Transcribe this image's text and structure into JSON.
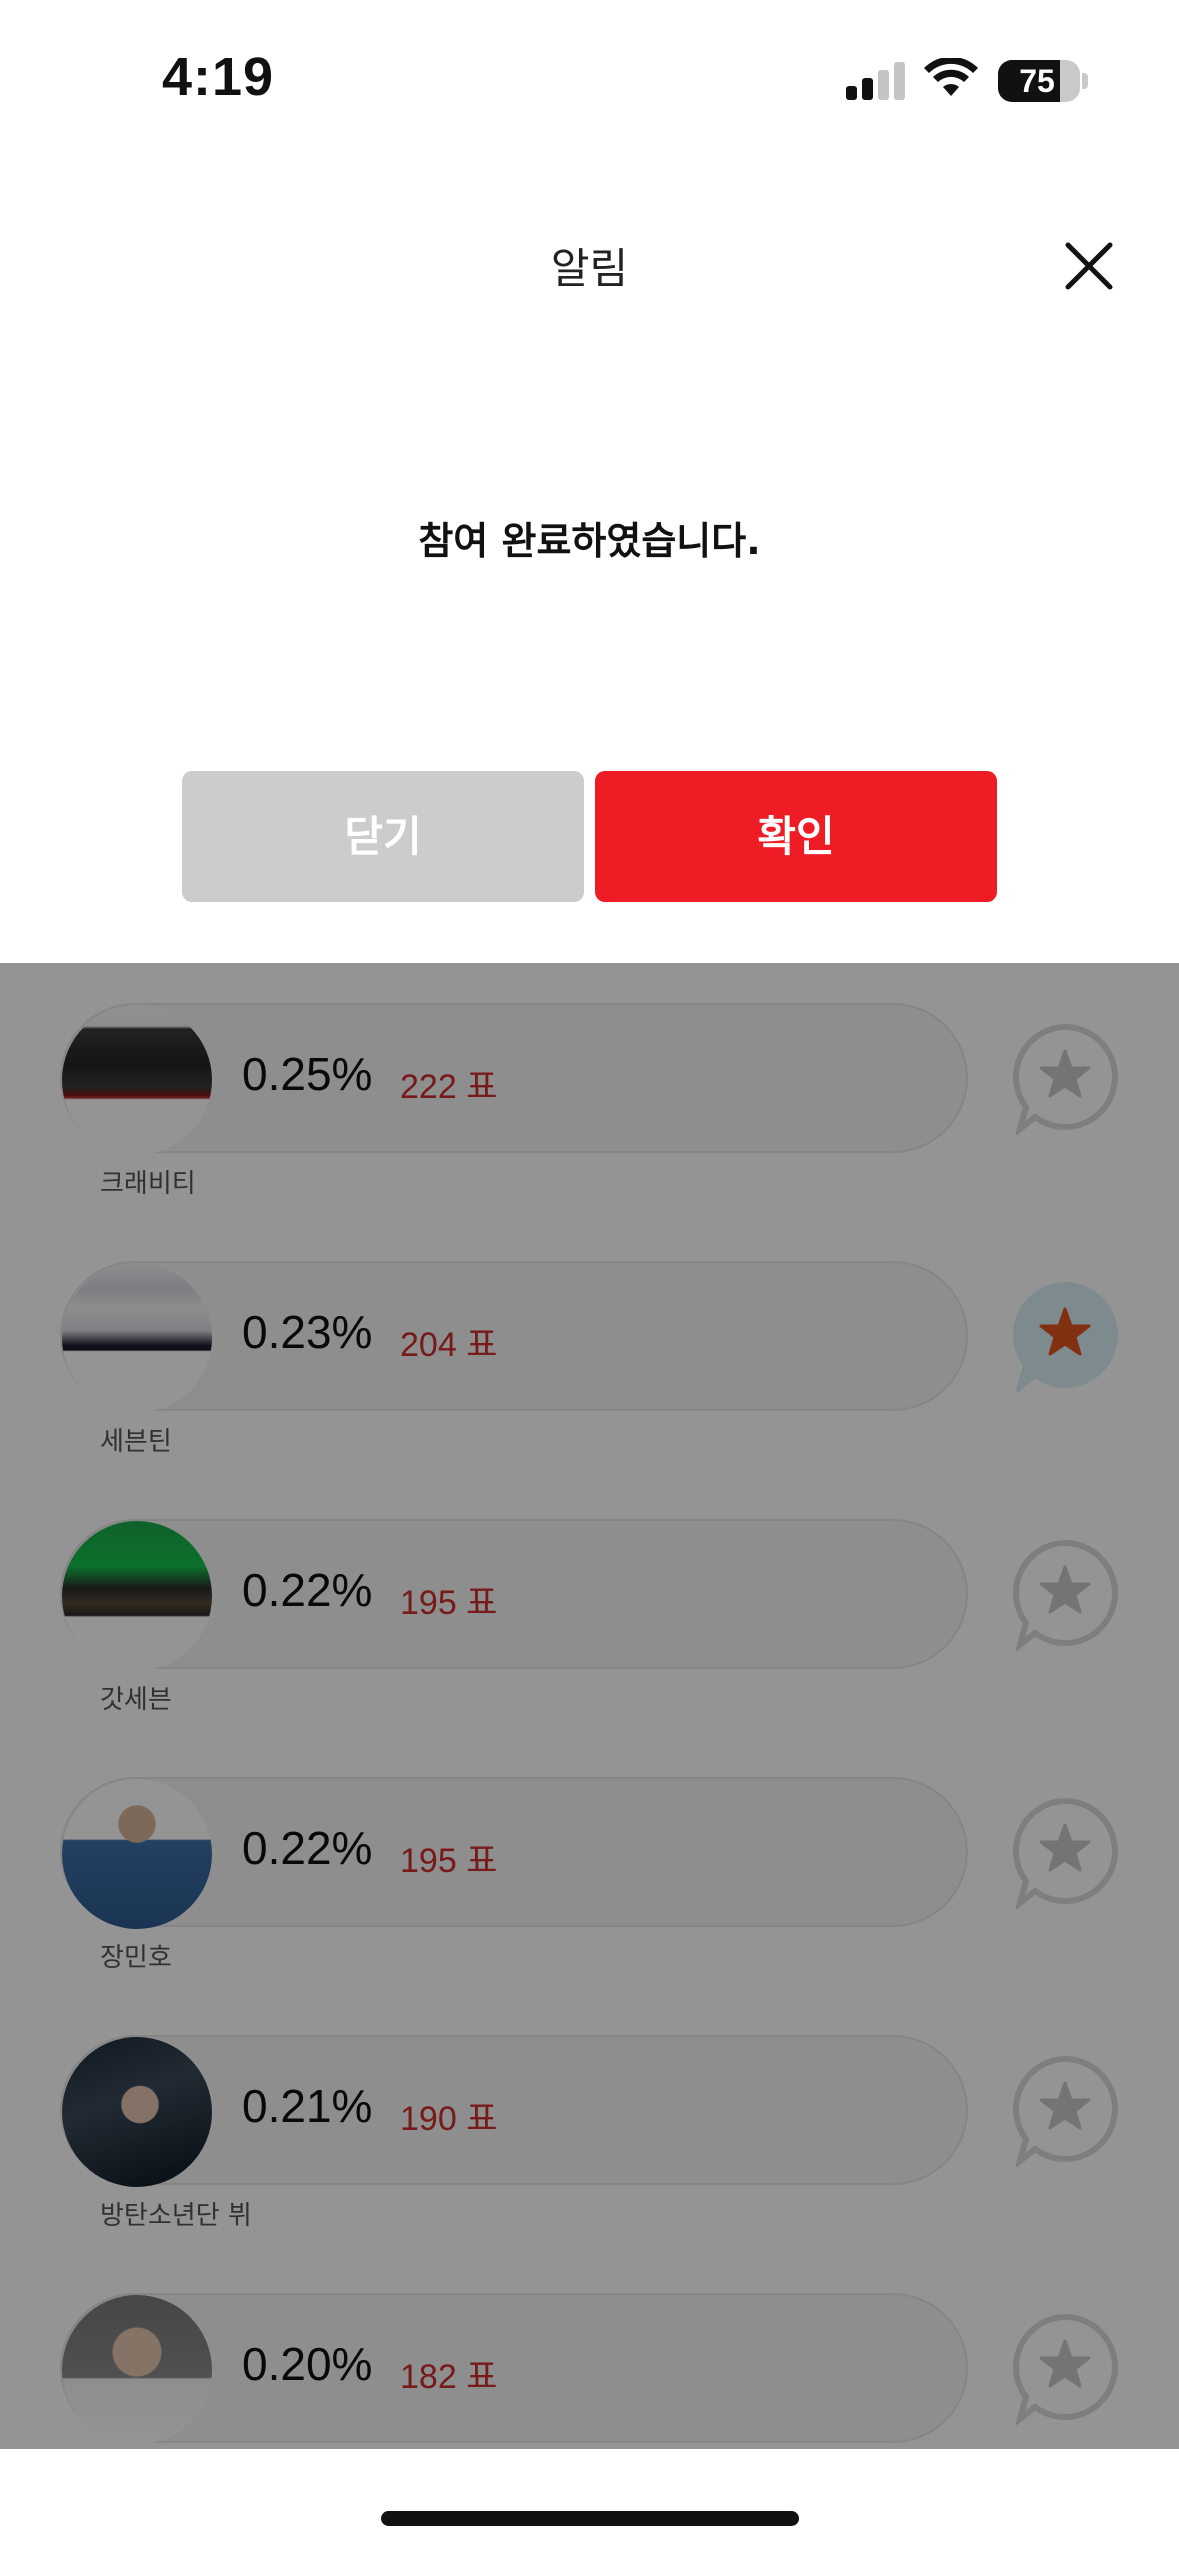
{
  "status_bar": {
    "time": "4:19",
    "battery_percent": "75",
    "battery_level": 0.75,
    "signal_bars_active": 2,
    "signal_bars_total": 4
  },
  "dialog": {
    "title": "알림",
    "message": "참여 완료하였습니다.",
    "close_label": "닫기",
    "confirm_label": "확인",
    "close_icon": "close-icon",
    "colors": {
      "confirm": "#ee1c25",
      "close": "#cccccc"
    }
  },
  "ranking": {
    "items": [
      {
        "name": "크래비티",
        "percent": "0.25%",
        "votes": "222 표",
        "starred": false,
        "avatar": "group-dark"
      },
      {
        "name": "세븐틴",
        "percent": "0.23%",
        "votes": "204 표",
        "starred": true,
        "avatar": "group-white"
      },
      {
        "name": "갓세븐",
        "percent": "0.22%",
        "votes": "195 표",
        "starred": false,
        "avatar": "group-green"
      },
      {
        "name": "장민호",
        "percent": "0.22%",
        "votes": "195 표",
        "starred": false,
        "avatar": "person-denim"
      },
      {
        "name": "방탄소년단 뷔",
        "percent": "0.21%",
        "votes": "190 표",
        "starred": false,
        "avatar": "person-dark"
      },
      {
        "name": "",
        "percent": "0.20%",
        "votes": "182 표",
        "starred": false,
        "avatar": "person-white"
      }
    ],
    "colors": {
      "votes": "#cc2d2d",
      "star_active": "#e0531f",
      "star_active_bg": "#d9f0f4"
    }
  }
}
